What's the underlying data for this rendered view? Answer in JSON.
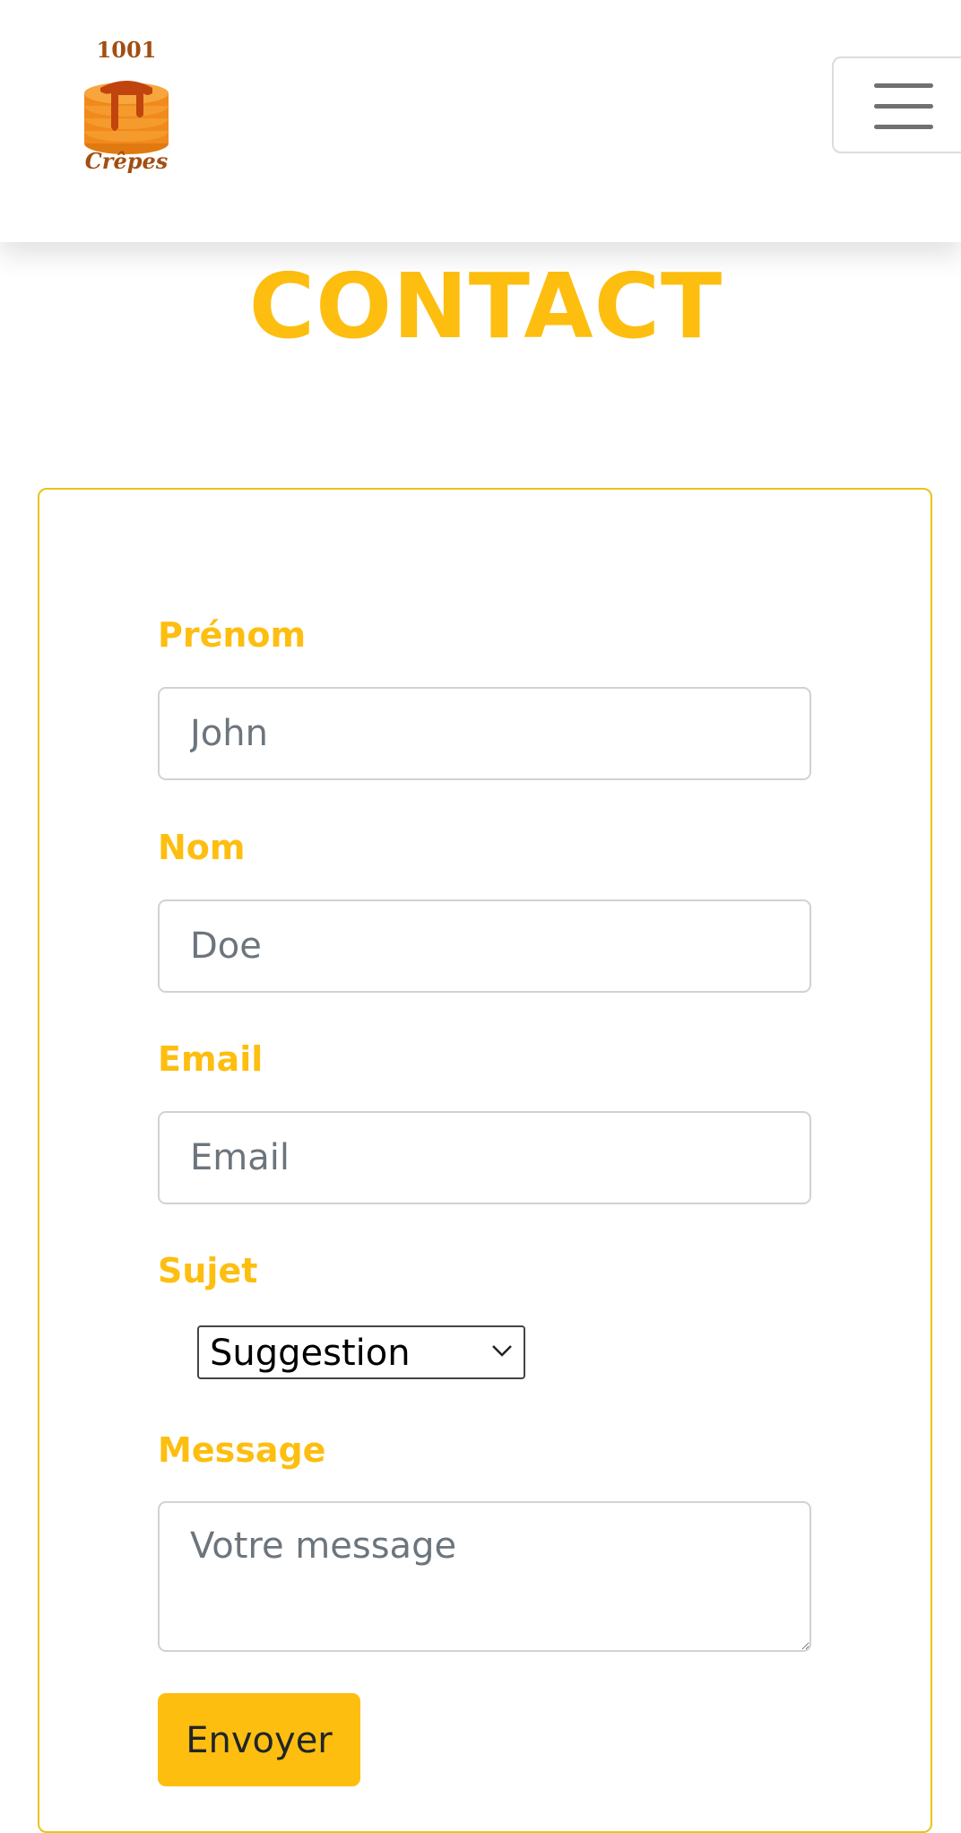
{
  "brand": {
    "logo_top_text": "1001",
    "logo_bottom_text": "Crêpes",
    "logo_colors": {
      "stack": "#f08a1c",
      "syrup": "#c1440e",
      "text": "#a24e12"
    }
  },
  "header": {
    "menu_icon": "hamburger-icon"
  },
  "page": {
    "title": "CONTACT"
  },
  "form": {
    "first_name": {
      "label": "Prénom",
      "placeholder": "John"
    },
    "last_name": {
      "label": "Nom",
      "placeholder": "Doe"
    },
    "email": {
      "label": "Email",
      "placeholder": "Email"
    },
    "subject": {
      "label": "Sujet",
      "selected": "Suggestion",
      "icon": "chevron-down-icon"
    },
    "message": {
      "label": "Message",
      "placeholder": "Votre message"
    },
    "submit_label": "Envoyer"
  },
  "colors": {
    "accent": "#fdbe10",
    "card_border": "#e6c619",
    "input_border": "#cfd2d6",
    "placeholder": "#6c757d"
  }
}
